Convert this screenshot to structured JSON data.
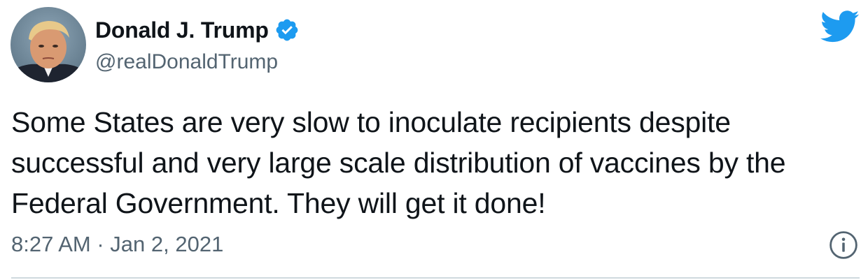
{
  "tweet": {
    "display_name": "Donald J. Trump",
    "handle": "@realDonaldTrump",
    "text": "Some States are very slow to inoculate recipients despite successful and very large scale distribution of vaccines by the Federal Government. They will get it done!",
    "timestamp": "8:27 AM · Jan 2, 2021",
    "verified": true
  },
  "icons": {
    "verified": "verified-badge-icon",
    "brand": "twitter-bird-icon",
    "info": "info-icon"
  },
  "colors": {
    "brand_blue": "#1d9bf0",
    "text_primary": "#0f1419",
    "text_secondary": "#536471",
    "divider": "#cfd9de"
  }
}
